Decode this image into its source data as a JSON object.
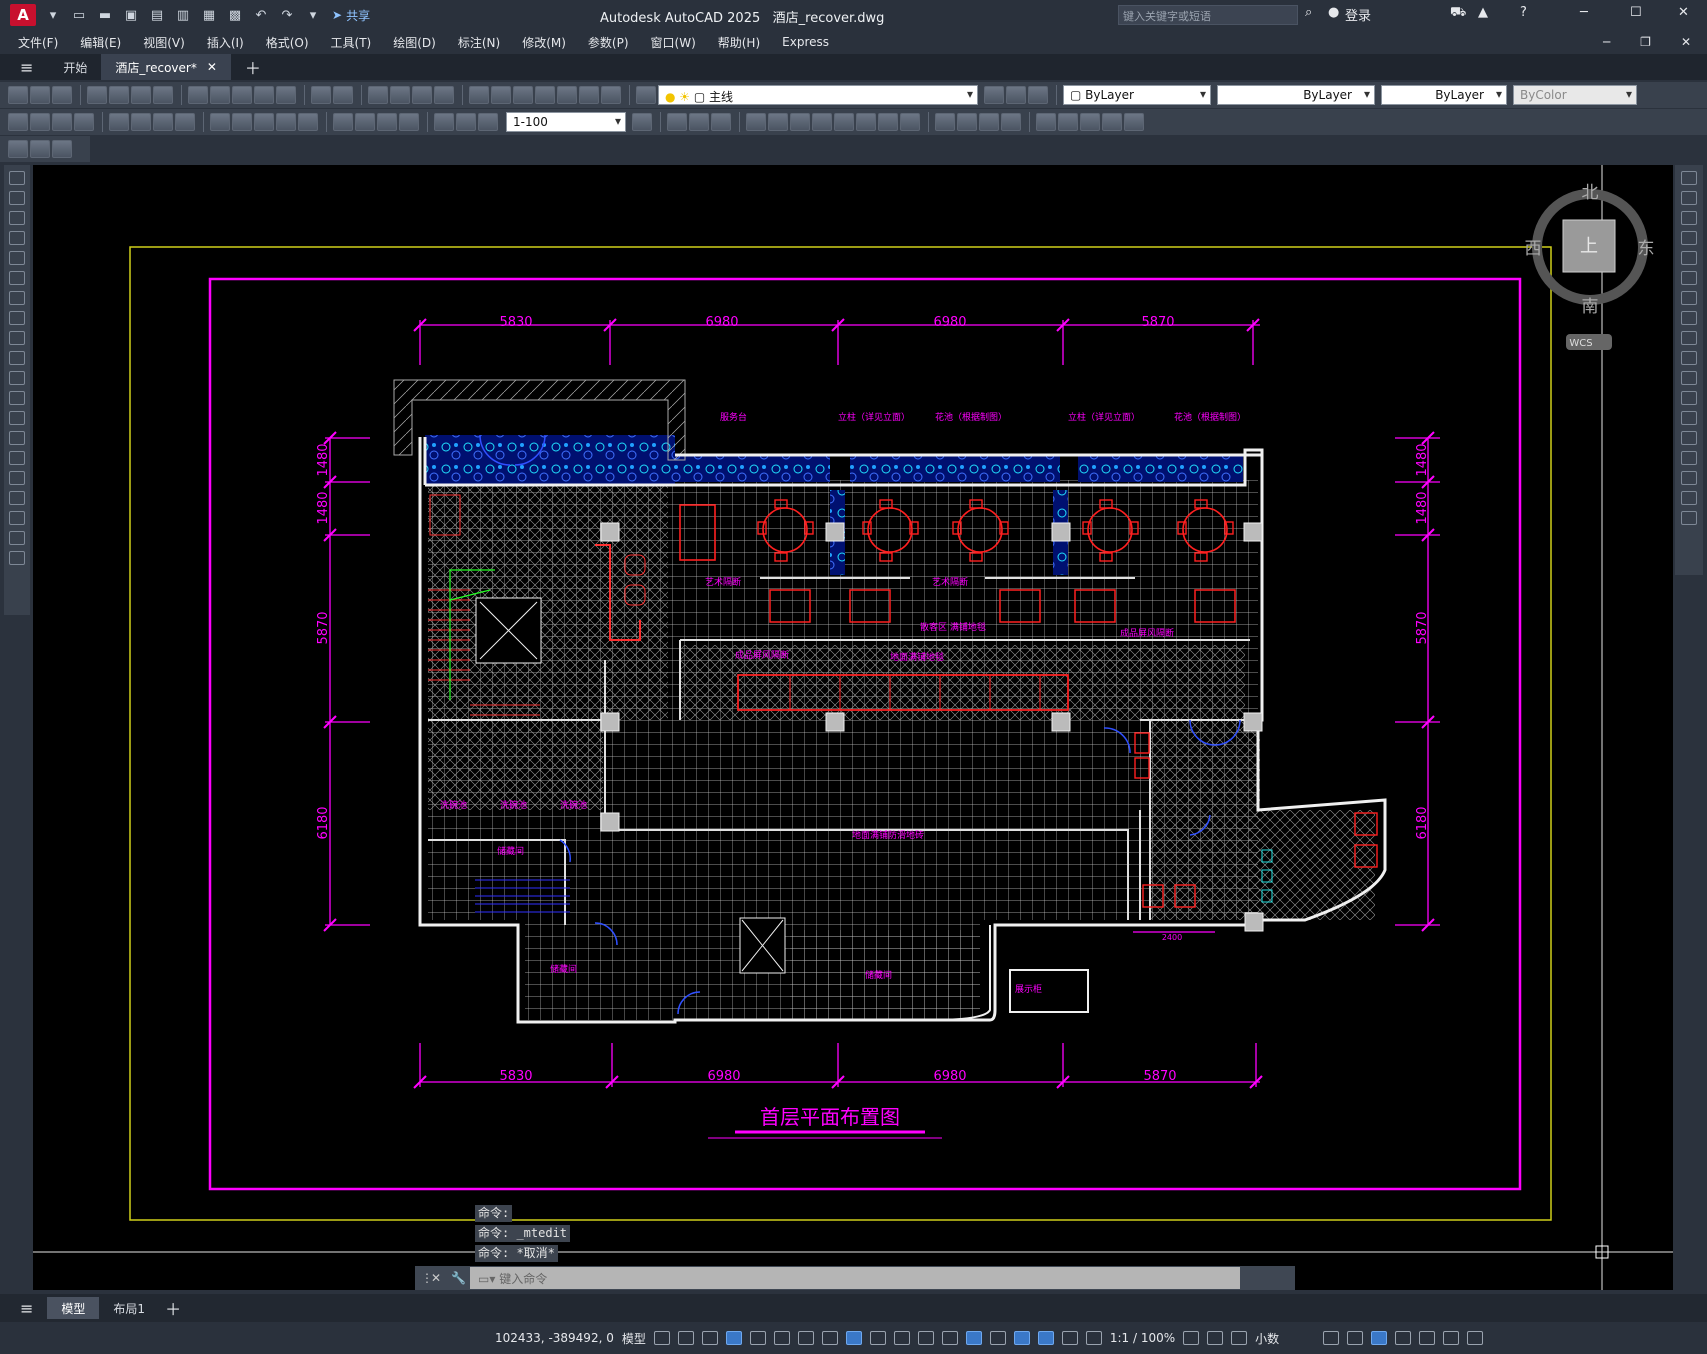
{
  "app": {
    "title": "Autodesk AutoCAD 2025",
    "file": "酒店_recover.dwg",
    "logo_letter": "A",
    "share": "共享",
    "search_placeholder": "键入关键字或短语",
    "login": "登录"
  },
  "menu": [
    "文件(F)",
    "编辑(E)",
    "视图(V)",
    "插入(I)",
    "格式(O)",
    "工具(T)",
    "绘图(D)",
    "标注(N)",
    "修改(M)",
    "参数(P)",
    "窗口(W)",
    "帮助(H)",
    "Express"
  ],
  "tabs": {
    "start": "开始",
    "doc": "酒店_recover*"
  },
  "toolbar": {
    "layer": "主线",
    "color": "ByLayer",
    "linetype": "ByLayer",
    "lineweight": "ByLayer",
    "plotstyle": "ByColor",
    "scale": "1-100"
  },
  "viewcube": {
    "north": "北",
    "south": "南",
    "east": "东",
    "west": "西",
    "face": "上",
    "ucs": "WCS"
  },
  "drawing": {
    "title": "首层平面布置图",
    "dims_top": [
      "5830",
      "6980",
      "6980",
      "5870"
    ],
    "dims_bottom": [
      "5830",
      "6980",
      "6980",
      "5870"
    ],
    "dims_left": [
      "1480",
      "1480",
      "5870",
      "6180"
    ],
    "dims_right": [
      "1480",
      "1480",
      "5870",
      "6180"
    ],
    "small_dim": "2400",
    "labels": {
      "l1": "服务台",
      "l2": "立柱（详见立面）",
      "l3": "花池（根据制图）",
      "l4": "立柱（详见立面）",
      "l5": "花池（根据制图）",
      "l6": "艺术隔断",
      "l7": "艺术隔断",
      "l8": "散客区 满铺地毯",
      "l9": "成品屏风隔断",
      "l10": "成品屏风隔断",
      "l11": "地面满铺地毯",
      "l12": "洗碗池",
      "l13": "洗碗池",
      "l14": "洗碗池",
      "l15": "储藏间",
      "l16": "地面满铺防滑地砖",
      "l17": "储藏间",
      "l18": "储藏间",
      "l19": "展示柜"
    }
  },
  "command": {
    "history": [
      "命令:",
      "命令: _mtedit",
      "命令: *取消*"
    ],
    "placeholder": "键入命令"
  },
  "layouts": {
    "model": "模型",
    "layout1": "布局1"
  },
  "status": {
    "coords": "102433, -389492, 0",
    "model": "模型",
    "scale": "1:1 / 100%",
    "units": "小数"
  }
}
